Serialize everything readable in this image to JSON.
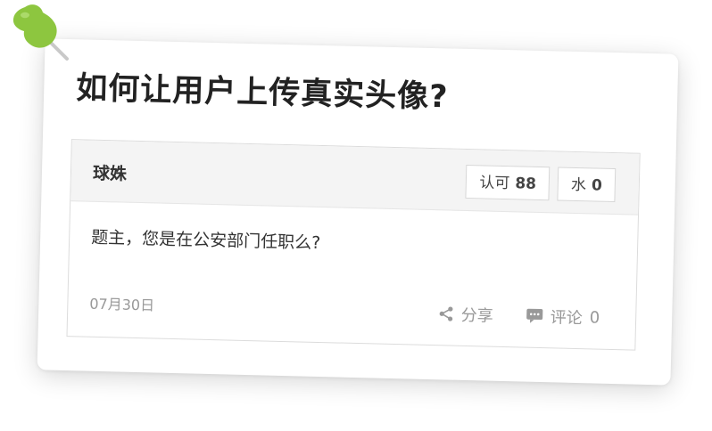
{
  "question": {
    "title": "如何让用户上传真实头像?"
  },
  "answer": {
    "author": "球姝",
    "vote_up_label": "认可",
    "vote_up_count": "88",
    "vote_water_label": "水",
    "vote_water_count": "0",
    "content": "题主，您是在公安部门任职么?",
    "date": "07月30日",
    "share_label": "分享",
    "comment_label": "评论",
    "comment_count": "0"
  },
  "icons": {
    "pin": "pushpin-icon",
    "share": "share-icon",
    "comment": "comment-icon"
  },
  "colors": {
    "pin": "#8dc63f",
    "text": "#222222",
    "muted": "#999999",
    "header_bg": "#f4f4f4"
  }
}
